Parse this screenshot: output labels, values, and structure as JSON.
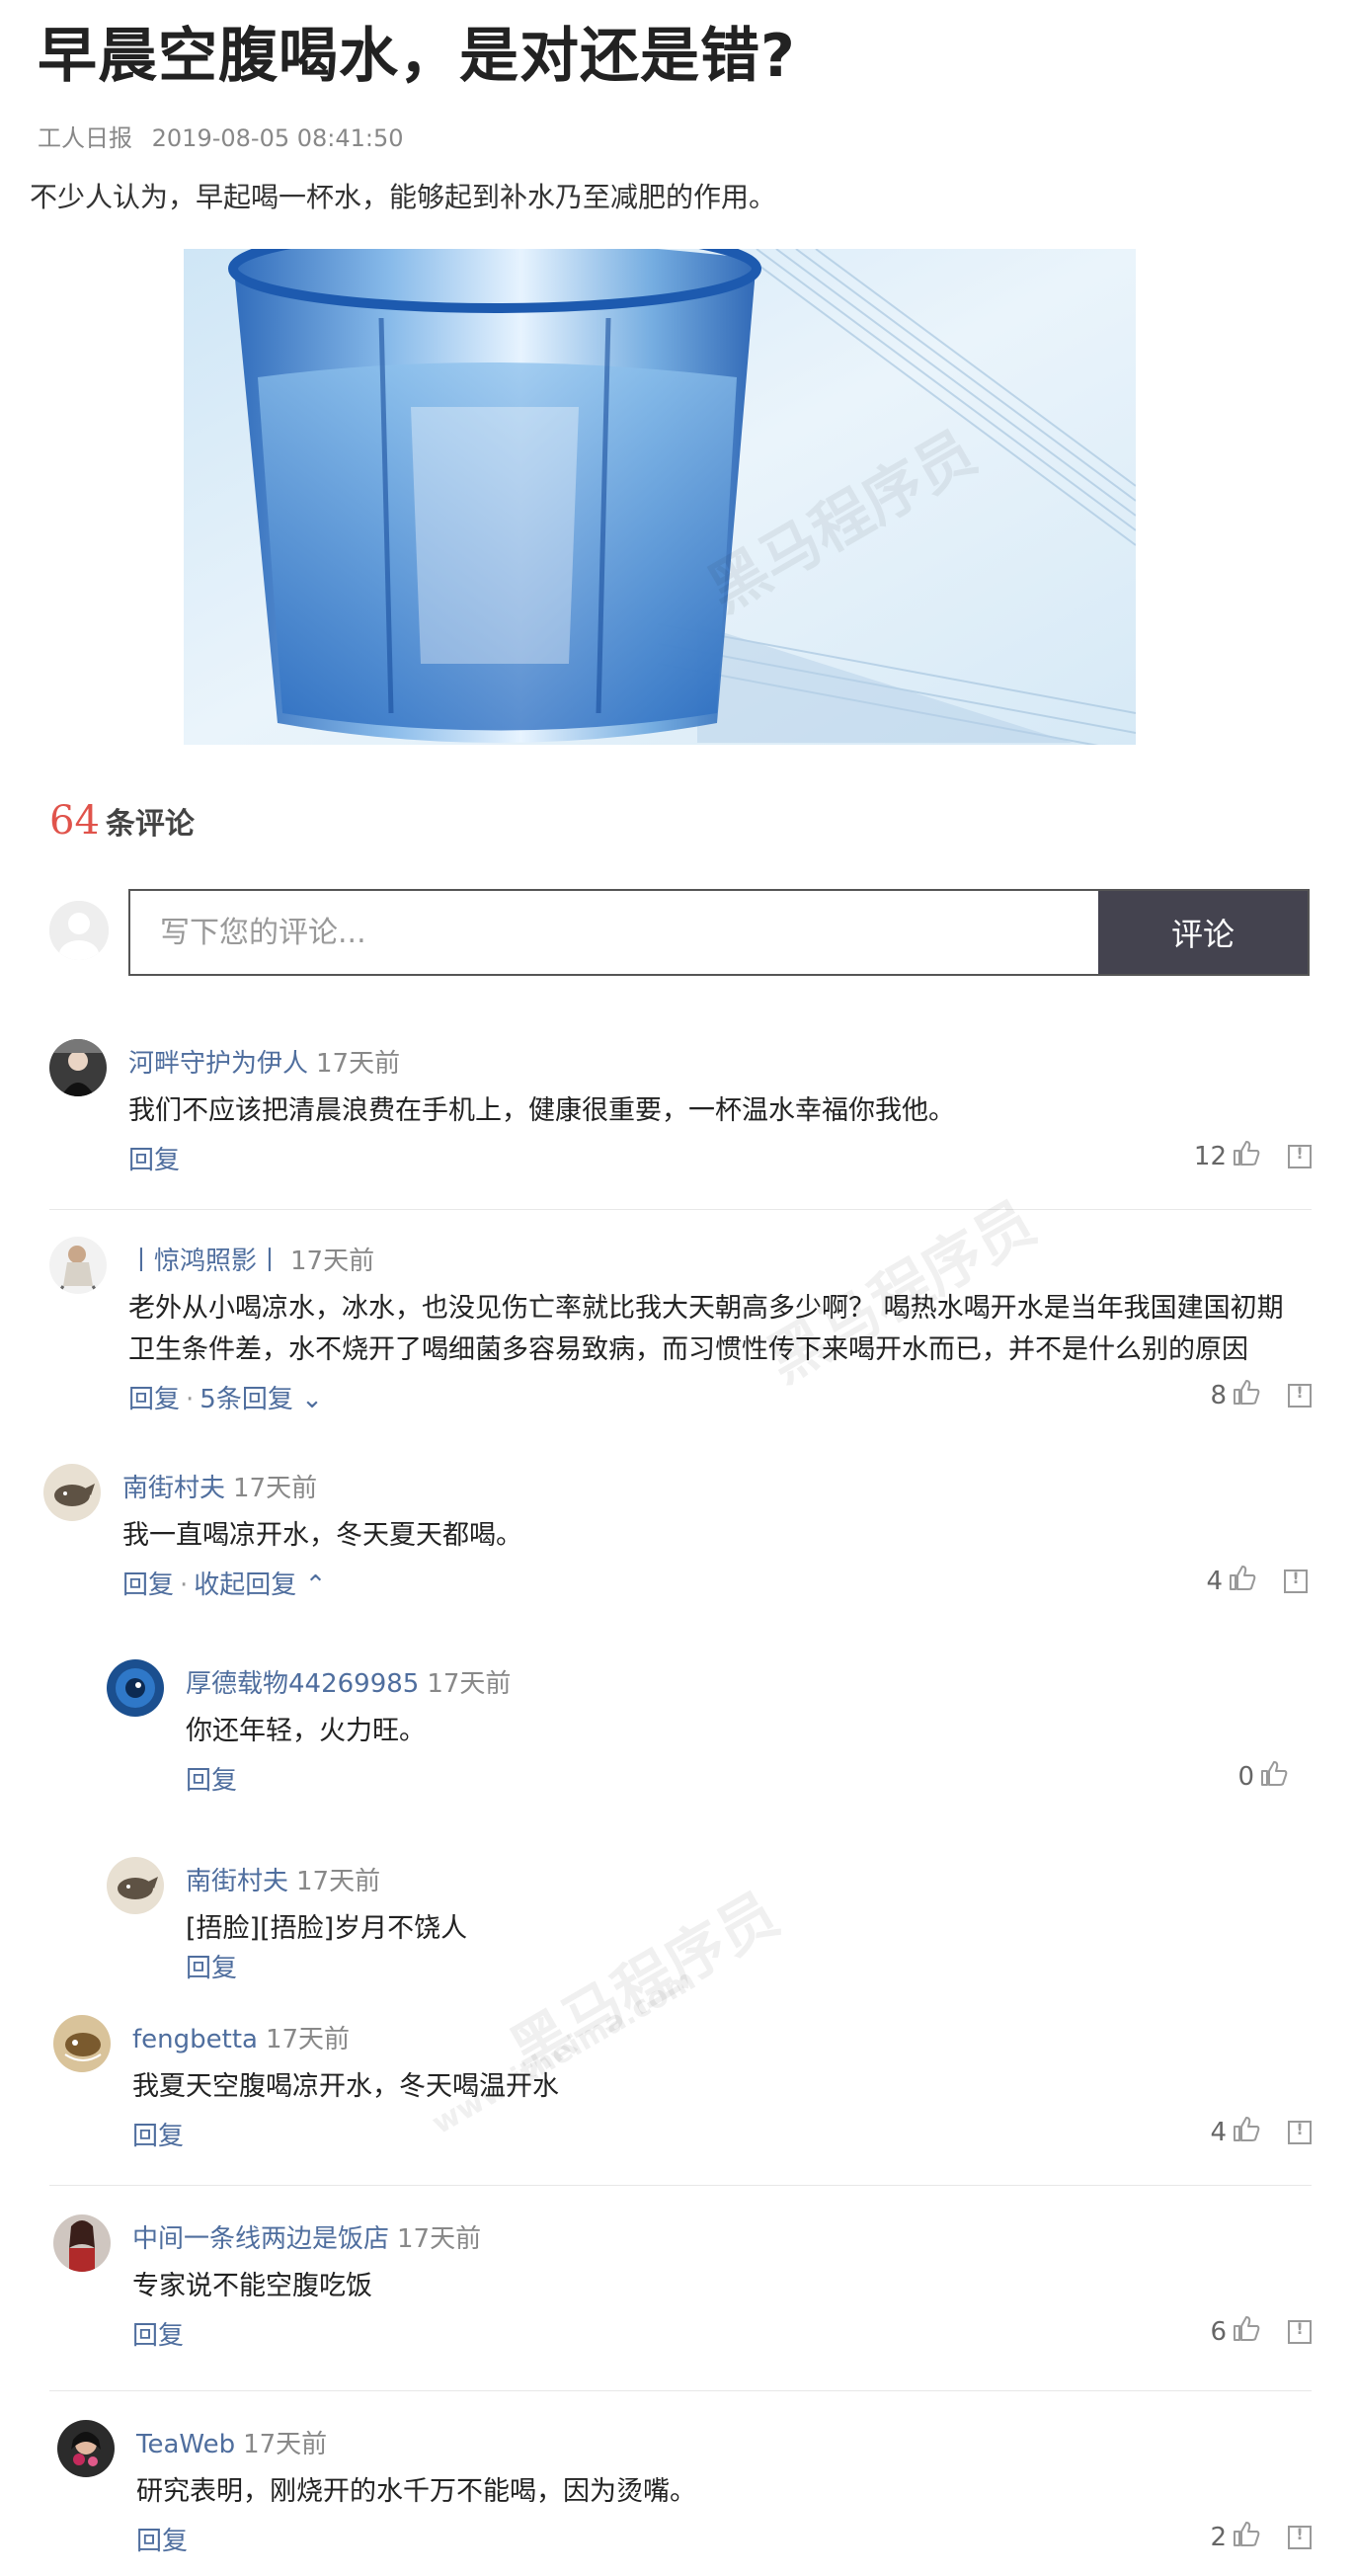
{
  "article": {
    "title": "早晨空腹喝水，是对还是错?",
    "source": "工人日报",
    "date": "2019-08-05 08:41:50",
    "intro": "不少人认为，早起喝一杯水，能够起到补水乃至减肥的作用。"
  },
  "comments_header": {
    "count": "64",
    "label": "条评论"
  },
  "comment_form": {
    "placeholder": "写下您的评论...",
    "submit_label": "评论"
  },
  "comments": [
    {
      "user": "河畔守护为伊人",
      "time": "17天前",
      "text": "我们不应该把清晨浪费在手机上，健康很重要，一杯温水幸福你我他。",
      "reply": "回复",
      "likes": "12"
    },
    {
      "user": "丨惊鸿照影丨",
      "time": "17天前",
      "text_line1": "老外从小喝凉水，冰水，也没见伤亡率就比我大天朝高多少啊？ 喝热水喝开水是当年我国建国初期",
      "text_line2": "卫生条件差，水不烧开了喝细菌多容易致病，而习惯性传下来喝开水而已，并不是什么别的原因",
      "reply": "回复",
      "sub_replies": "5条回复",
      "likes": "8"
    },
    {
      "user": "南街村夫",
      "time": "17天前",
      "text": "我一直喝凉开水，冬天夏天都喝。",
      "reply": "回复",
      "collapse": "收起回复",
      "likes": "4"
    },
    {
      "user": "厚德载物44269985",
      "time": "17天前",
      "text": "你还年轻，火力旺。",
      "reply": "回复",
      "likes": "0"
    },
    {
      "user": "南街村夫",
      "time": "17天前",
      "text": "[捂脸][捂脸]岁月不饶人",
      "reply": "回复"
    },
    {
      "user": "fengbetta",
      "time": "17天前",
      "text": "我夏天空腹喝凉开水，冬天喝温开水",
      "reply": "回复",
      "likes": "4"
    },
    {
      "user": "中间一条线两边是饭店",
      "time": "17天前",
      "text": "专家说不能空腹吃饭",
      "reply": "回复",
      "likes": "6"
    },
    {
      "user": "TeaWeb",
      "time": "17天前",
      "text": "研究表明，刚烧开的水千万不能喝，因为烫嘴。",
      "reply": "回复",
      "likes": "2"
    }
  ],
  "icons": {
    "like": "thumbs-up-icon",
    "report": "report-icon",
    "expand": "chevron-down-icon",
    "collapse": "chevron-up-icon"
  },
  "colors": {
    "link": "#4f6e9e",
    "count": "#e0534b",
    "button_bg": "#44434f"
  },
  "watermark": {
    "brand": "黑马程序员",
    "url": "www.itheima.com"
  }
}
